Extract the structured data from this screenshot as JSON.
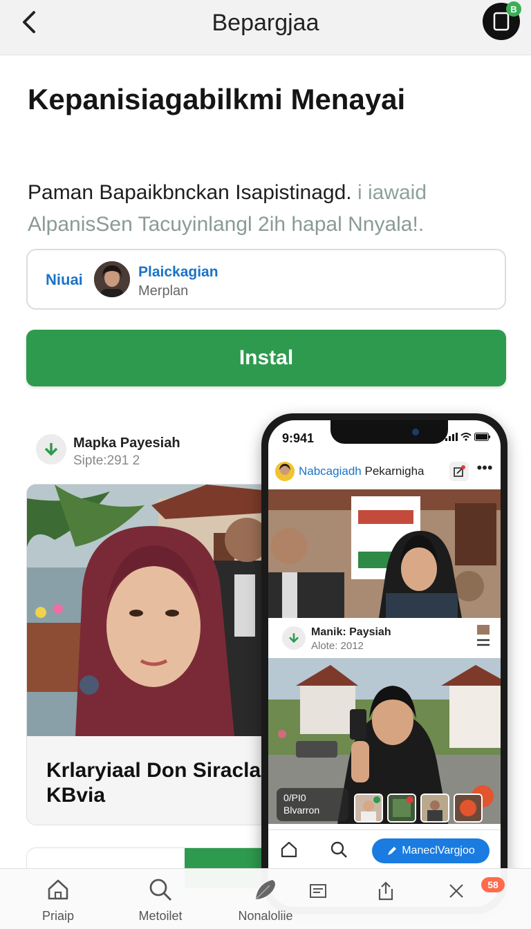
{
  "header": {
    "title": "Bepargjaa",
    "badge": "B"
  },
  "main": {
    "title": "Kepanisiagabilkmi Menayai",
    "desc_line1": "Paman Bapaikbnckan Isapistinagd.",
    "desc_line1_muted": "i iawaid",
    "desc_line2": "AlpanisSen Tacuyinlangl 2ih hapal Nnyala!."
  },
  "developer": {
    "label": "Niuai",
    "name": "Plaickagian",
    "subtitle": "Merplan"
  },
  "install_button": "Instal",
  "feature_post": {
    "name": "Mapka Payesiah",
    "subtitle": "Sipte:291 2",
    "caption": "Krlaryiaal Don Siraclar KBvia"
  },
  "phone": {
    "time": "9:941",
    "app_title_blue": "Nabcagiadh",
    "app_title_dark": "Pekarnigha",
    "more": "•••",
    "inner_post": {
      "name": "Manik: Paysiah",
      "subtitle": "Alote: 2012"
    },
    "overlay_line1": "0/PI0",
    "overlay_line2": "Blvarron",
    "cta": "ManeclVargjoo"
  },
  "bottom_nav": {
    "items": [
      {
        "label": "Priaip",
        "icon": "home-icon"
      },
      {
        "label": "Metoilet",
        "icon": "search-icon"
      },
      {
        "label": "Nonaloliie",
        "icon": "feather-icon"
      }
    ],
    "tools": [
      "document-icon",
      "share-icon",
      "close-icon"
    ],
    "badge_count": "58"
  },
  "colors": {
    "accent_green": "#2e9a4e",
    "link_blue": "#1a73c8",
    "cta_blue": "#1a7be0",
    "badge_orange": "#ff6a4d"
  }
}
